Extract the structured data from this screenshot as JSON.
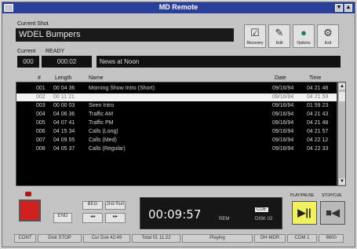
{
  "window": {
    "title": "MD Remote",
    "minimize": "▼",
    "maximize": "▲"
  },
  "labels": {
    "current_shot": "Current Shot",
    "current": "Current",
    "ready": "READY"
  },
  "shot_name": "WDEL Bumpers",
  "pointers": {
    "a": "000",
    "b": "000:02",
    "name": "News at Noon"
  },
  "toolbar": [
    {
      "label": "Recovery",
      "icon": "checkbox-icon",
      "glyph": "☑"
    },
    {
      "label": "Edit",
      "icon": "edit-icon",
      "glyph": "✎"
    },
    {
      "label": "Options",
      "icon": "options-icon",
      "glyph": "●"
    },
    {
      "label": "Exit",
      "icon": "exit-icon",
      "glyph": "⚙"
    }
  ],
  "columns": {
    "num": "#",
    "length": "Length",
    "name": "Name",
    "date": "Date",
    "time": "Time"
  },
  "rows": [
    {
      "mark": "",
      "num": "001",
      "length": "00 04 36",
      "name": "Morning Show Intro (Short)",
      "date": "09/16/94",
      "time": "04 21 48"
    },
    {
      "mark": "",
      "num": "002",
      "length": "00 11 21",
      "name": "",
      "date": "09/16/94",
      "time": "04 21 59"
    },
    {
      "mark": "",
      "num": "003",
      "length": "00 00 03",
      "name": "Siren Intro",
      "date": "09/16/94",
      "time": "01 59 23"
    },
    {
      "mark": "",
      "num": "004",
      "length": "04 06 36",
      "name": "Traffic AM",
      "date": "09/16/94",
      "time": "04 21 43"
    },
    {
      "mark": "",
      "num": "005",
      "length": "04 07 41",
      "name": "Traffic PM",
      "date": "09/16/94",
      "time": "04 21 48"
    },
    {
      "mark": "",
      "num": "006",
      "length": "04 15 34",
      "name": "Calls (Long)",
      "date": "09/16/94",
      "time": "04 21 57"
    },
    {
      "mark": "",
      "num": "007",
      "length": "04 09 55",
      "name": "Calls (Med)",
      "date": "09/16/94",
      "time": "04 22 12"
    },
    {
      "mark": "",
      "num": "008",
      "length": "04 05 37",
      "name": "Calls (Regular)",
      "date": "09/16/94",
      "time": "04 22 33"
    }
  ],
  "transport": {
    "prev": "◂◂",
    "next": "▸▸",
    "end": "END",
    "start": "BEG",
    "end2": "2nd Run"
  },
  "display": {
    "time": "00:09:57",
    "rem": "REM",
    "cue": "CUE",
    "disk": "DISK 02"
  },
  "play_label": "PLAY/PAUSE",
  "stop_label": "STOP/CUE",
  "play_glyph": "▶||",
  "stop_glyph": "■◀",
  "status": {
    "cont": "CONT",
    "mode": "Disk   STOP",
    "cur_disk": "Cur Dsk  42:49",
    "total": "Total 01 11:22",
    "state": "Playing",
    "mdr": "DH-MDR",
    "com": "COM 1",
    "baud": "9600"
  },
  "colors": {
    "titlebar": "#2a3f9a",
    "play": "#f0f060",
    "record": "#d02020"
  }
}
